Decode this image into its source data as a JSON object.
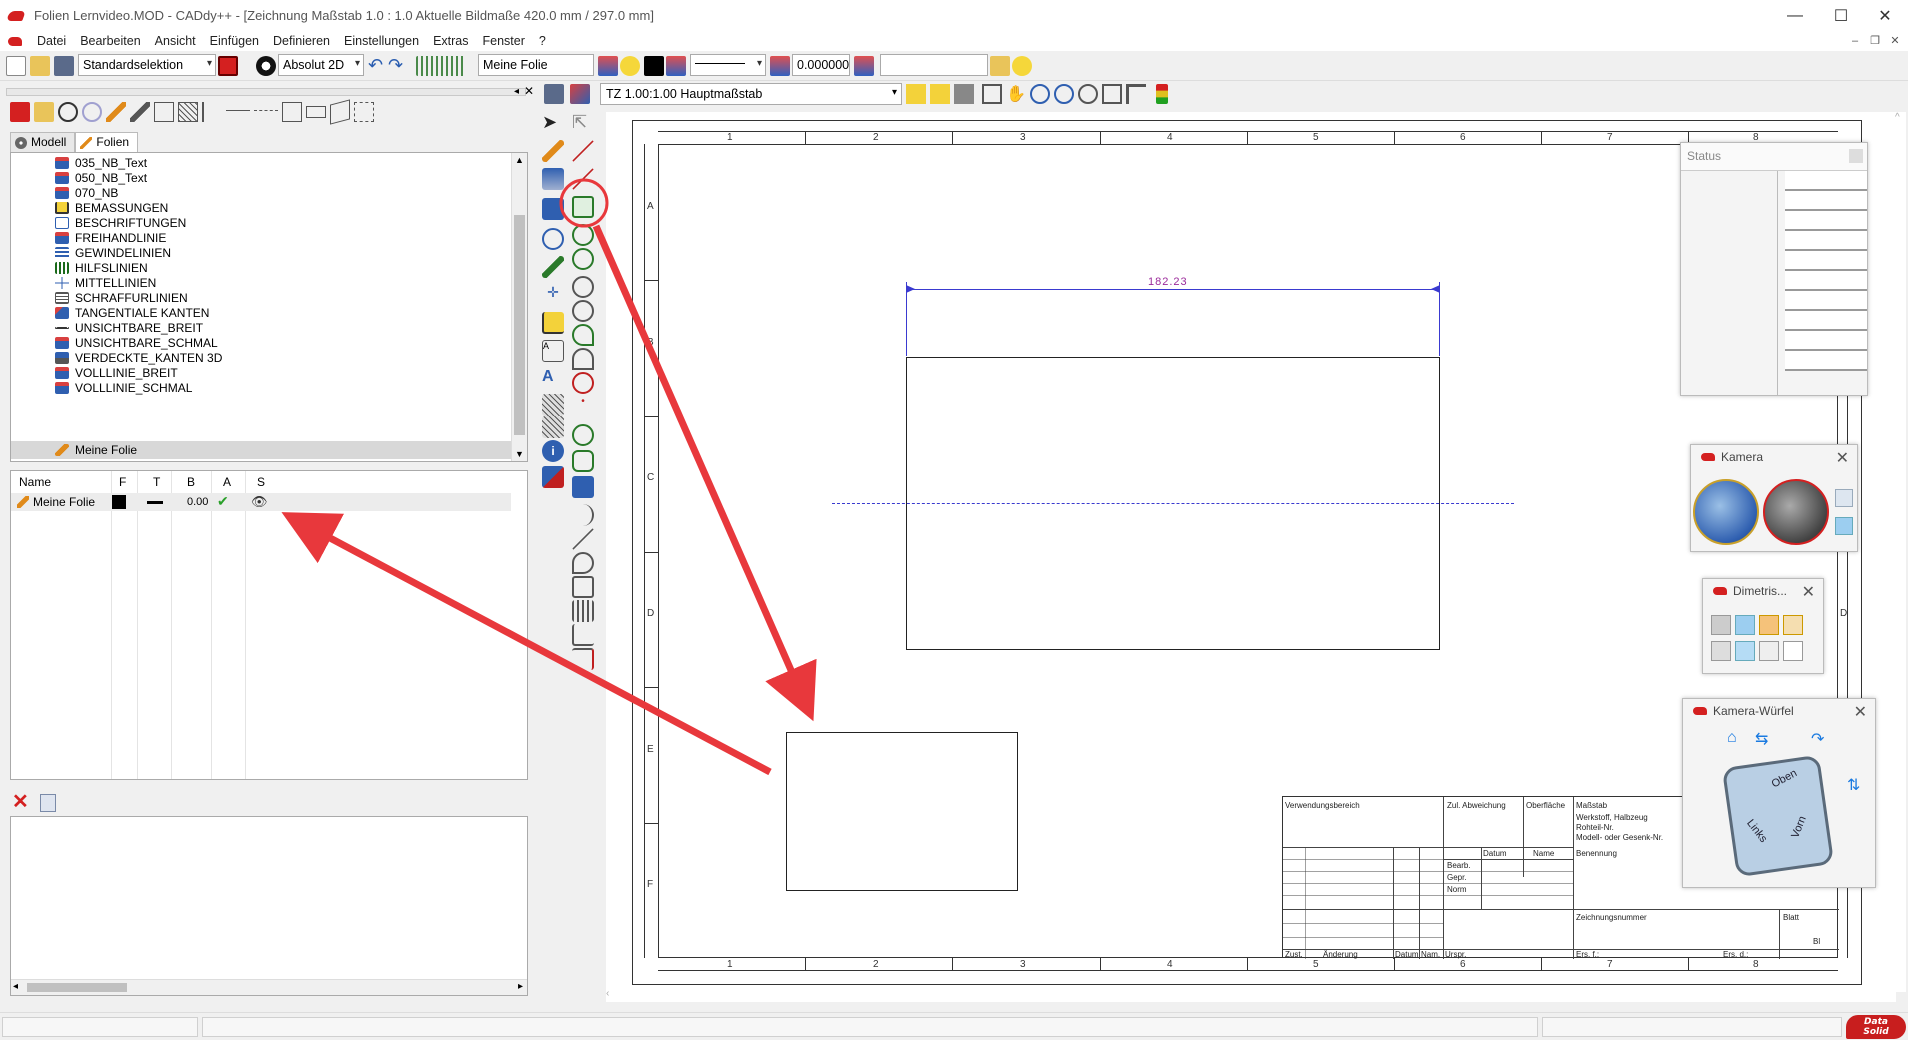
{
  "window": {
    "title": "Folien Lernvideo.MOD  -  CADdy++ - [Zeichnung   Maßstab 1.0 : 1.0   Aktuelle Bildmaße 420.0 mm / 297.0 mm]",
    "minimize": "—",
    "maximize": "☐",
    "close": "✕"
  },
  "menu": {
    "items": [
      "Datei",
      "Bearbeiten",
      "Ansicht",
      "Einfügen",
      "Definieren",
      "Einstellungen",
      "Extras",
      "Fenster",
      "?"
    ]
  },
  "toolbar": {
    "selection_mode": "Standardselektion",
    "coord_mode": "Absolut 2D",
    "layer_name": "Meine Folie",
    "numeric_value": "0.000000",
    "scale_combo": "TZ 1.00:1.00 Hauptmaßstab",
    "color_accent": "#d42020"
  },
  "panel": {
    "tabs": [
      "Modell",
      "Folien"
    ],
    "tree_items": [
      {
        "label": "035_NB_Text",
        "icon": "layer-stack-icon"
      },
      {
        "label": "050_NB_Text",
        "icon": "layer-stack-icon"
      },
      {
        "label": "070_NB",
        "icon": "layer-stack-icon"
      },
      {
        "label": "BEMASSUNGEN",
        "icon": "dimension-icon"
      },
      {
        "label": "BESCHRIFTUNGEN",
        "icon": "annotation-icon"
      },
      {
        "label": "FREIHANDLINIE",
        "icon": "layer-stack-icon"
      },
      {
        "label": "GEWINDELINIEN",
        "icon": "thread-icon"
      },
      {
        "label": "HILFSLINIEN",
        "icon": "helper-lines-icon"
      },
      {
        "label": "MITTELLINIEN",
        "icon": "centerline-icon"
      },
      {
        "label": "SCHRAFFURLINIEN",
        "icon": "hatch-icon"
      },
      {
        "label": "TANGENTIALE KANTEN",
        "icon": "tangent-icon"
      },
      {
        "label": "UNSICHTBARE_BREIT",
        "icon": "hidden-line-icon"
      },
      {
        "label": "UNSICHTBARE_SCHMAL",
        "icon": "layer-stack-icon"
      },
      {
        "label": "VERDECKTE_KANTEN 3D",
        "icon": "cube-layer-icon"
      },
      {
        "label": "VOLLLINIE_BREIT",
        "icon": "layer-stack-icon"
      },
      {
        "label": "VOLLLINIE_SCHMAL",
        "icon": "layer-stack-icon"
      },
      {
        "label": "Meine Folie",
        "icon": "pencil-icon"
      }
    ],
    "layer_columns": [
      "Name",
      "F",
      "T",
      "B",
      "A",
      "S"
    ],
    "layer_row": {
      "name": "Meine Folie",
      "line_width": "0.00",
      "color": "#000000"
    }
  },
  "drawing": {
    "col_numbers": [
      "1",
      "2",
      "3",
      "4",
      "5",
      "6",
      "7",
      "8"
    ],
    "row_letters": [
      "A",
      "B",
      "C",
      "D",
      "E",
      "F"
    ],
    "dimension_value": "182.23",
    "dim_color": "#9b2a9b",
    "centerline_color": "#3a3ad0",
    "titleblock": {
      "verwendungsbereich": "Verwendungsbereich",
      "abweichung": "Zul. Abweichung",
      "oberflaeche": "Oberfläche",
      "massstab": "Maßstab",
      "werkstoff": "Werkstoff, Halbzeug",
      "rohteil": "Rohteil-Nr.",
      "modell": "Modell- oder Gesenk-Nr.",
      "datum": "Datum",
      "name": "Name",
      "benennung": "Benennung",
      "bearb": "Bearb.",
      "gepr": "Gepr.",
      "norm": "Norm",
      "zeichnungsnummer": "Zeichnungsnummer",
      "blatt": "Blatt",
      "bl": "Bl",
      "zust": "Zust.",
      "aenderung": "Änderung",
      "datum2": "Datum",
      "nam": "Nam.",
      "urspr": "Urspr.",
      "ers_f": "Ers. f.:",
      "ers_d": "Ers. d.:"
    }
  },
  "floats": {
    "status_title": "Status",
    "kamera_title": "Kamera",
    "dimetrisch_title": "Dimetris...",
    "wuerfel_title": "Kamera-Würfel",
    "cube_labels": {
      "top": "Oben",
      "left": "Links",
      "front": "Vorn"
    }
  },
  "annotation": {
    "arrow_color": "#e8383c"
  },
  "brand": {
    "line1": "Data",
    "line2": "Solid"
  }
}
